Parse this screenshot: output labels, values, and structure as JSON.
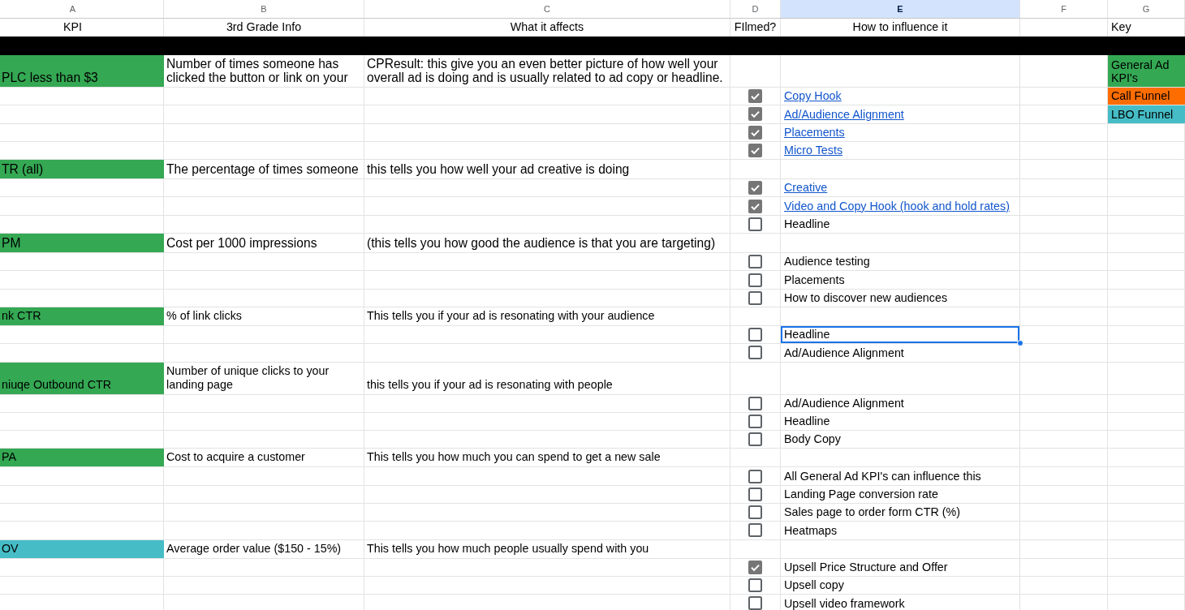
{
  "column_headers": [
    {
      "label": "A",
      "selected": false
    },
    {
      "label": "B",
      "selected": false
    },
    {
      "label": "C",
      "selected": false
    },
    {
      "label": "D",
      "selected": false
    },
    {
      "label": "E",
      "selected": true
    },
    {
      "label": "F",
      "selected": false
    },
    {
      "label": "G",
      "selected": false
    }
  ],
  "header_row": {
    "kpi": "KPI",
    "info": "3rd Grade Info",
    "affects": "What it affects",
    "filmed": "FIlmed?",
    "influence": "How to influence it",
    "key": "Key"
  },
  "key": [
    {
      "label": "General Ad KPI's",
      "color": "#34a853"
    },
    {
      "label": "Call Funnel",
      "color": "#ff6d01"
    },
    {
      "label": "LBO Funnel",
      "color": "#46bdc6"
    }
  ],
  "kpis": [
    {
      "name": "PLC less than $3",
      "info": "Number of times someone has clicked the button or link on your",
      "affects": "CPResult: this give you an even better picture of how well your overall ad is doing and is usually related to ad copy or headline.",
      "color": "#34a853",
      "factors": [
        {
          "label": "Copy Hook",
          "checked": true,
          "link": true,
          "selected": false
        },
        {
          "label": "Ad/Audience Alignment",
          "checked": true,
          "link": true,
          "selected": false
        },
        {
          "label": "Placements",
          "checked": true,
          "link": true,
          "selected": false
        },
        {
          "label": "Micro Tests",
          "checked": true,
          "link": true,
          "selected": false
        }
      ]
    },
    {
      "name": "TR (all)",
      "info": "The percentage of times someone",
      "affects": "this tells you how well your ad creative is doing",
      "color": "#34a853",
      "factors": [
        {
          "label": "Creative",
          "checked": true,
          "link": true,
          "selected": false
        },
        {
          "label": "Video and Copy Hook (hook and hold rates)",
          "checked": true,
          "link": true,
          "selected": false
        },
        {
          "label": "Headline",
          "checked": false,
          "link": false,
          "selected": false
        }
      ]
    },
    {
      "name": "PM",
      "info": "Cost per 1000 impressions",
      "affects": "(this tells you how good the audience is that you are targeting)",
      "color": "#34a853",
      "factors": [
        {
          "label": "Audience testing",
          "checked": false,
          "link": false,
          "selected": false
        },
        {
          "label": "Placements",
          "checked": false,
          "link": false,
          "selected": false
        },
        {
          "label": "How to discover new audiences",
          "checked": false,
          "link": false,
          "selected": false
        }
      ]
    },
    {
      "name": "nk CTR",
      "info": "% of link clicks",
      "affects": "This tells you if your ad is resonating with your audience",
      "color": "#34a853",
      "factors": [
        {
          "label": "Headline",
          "checked": false,
          "link": false,
          "selected": true
        },
        {
          "label": "Ad/Audience Alignment",
          "checked": false,
          "link": false,
          "selected": false
        }
      ]
    },
    {
      "name": "niuqe Outbound CTR",
      "info": "Number of unique clicks to your landing page",
      "affects": "this tells you if your ad is resonating with people",
      "color": "#34a853",
      "factors": [
        {
          "label": "Ad/Audience Alignment",
          "checked": false,
          "link": false,
          "selected": false
        },
        {
          "label": "Headline",
          "checked": false,
          "link": false,
          "selected": false
        },
        {
          "label": "Body Copy",
          "checked": false,
          "link": false,
          "selected": false
        }
      ]
    },
    {
      "name": "PA",
      "info": "Cost to acquire a customer",
      "affects": "This tells you how much you can spend to get a new sale",
      "color": "#34a853",
      "factors": [
        {
          "label": "All General Ad KPI's can influence this",
          "checked": false,
          "link": false,
          "selected": false
        },
        {
          "label": "Landing Page conversion rate",
          "checked": false,
          "link": false,
          "selected": false
        },
        {
          "label": "Sales page to order form CTR (%)",
          "checked": false,
          "link": false,
          "selected": false
        },
        {
          "label": "Heatmaps",
          "checked": false,
          "link": false,
          "selected": false
        }
      ]
    },
    {
      "name": "OV",
      "info": "Average order value ($150 - 15%)",
      "affects": "This tells you how much people usually spend with you",
      "color": "#46bdc6",
      "factors": [
        {
          "label": "Upsell Price Structure and Offer",
          "checked": true,
          "link": false,
          "selected": false
        },
        {
          "label": "Upsell copy",
          "checked": false,
          "link": false,
          "selected": false
        },
        {
          "label": "Upsell video framework",
          "checked": false,
          "link": false,
          "selected": false
        }
      ]
    }
  ]
}
